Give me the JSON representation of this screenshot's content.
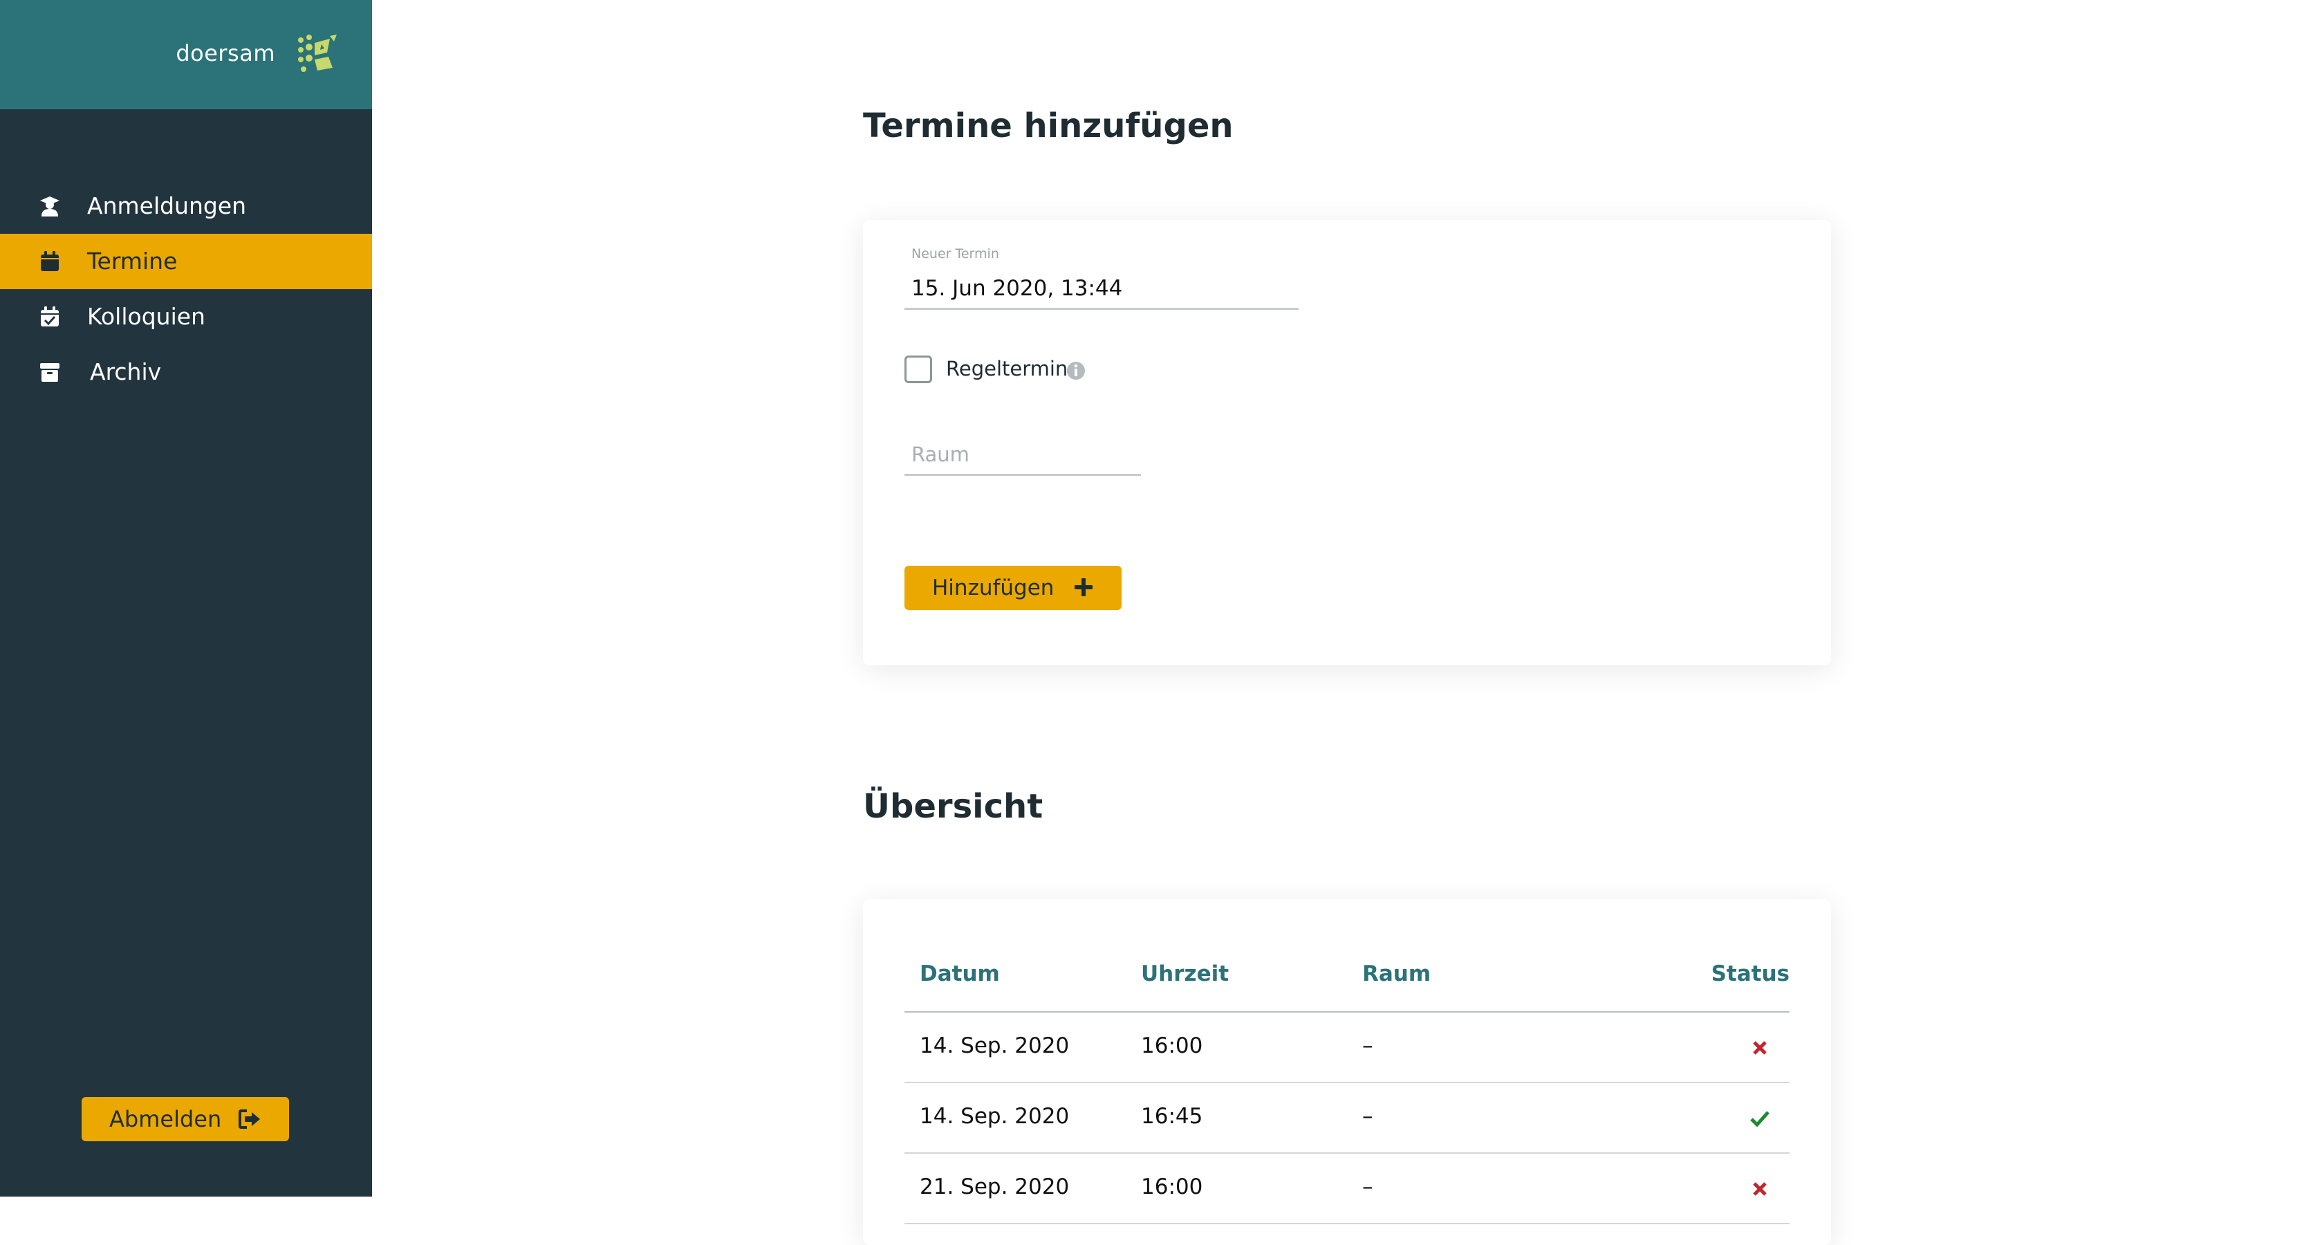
{
  "brand": {
    "name": "doersam",
    "logo_icon": "doersam-logo-icon"
  },
  "sidebar": {
    "items": [
      {
        "label": "Anmeldungen",
        "icon": "graduate-user-icon",
        "active": false
      },
      {
        "label": "Termine",
        "icon": "calendar-icon",
        "active": true
      },
      {
        "label": "Kolloquien",
        "icon": "calendar-check-icon",
        "active": false
      },
      {
        "label": "Archiv",
        "icon": "archive-box-icon",
        "active": false
      }
    ],
    "logout_label": "Abmelden",
    "logout_icon": "sign-out-icon"
  },
  "form": {
    "title": "Termine hinzufügen",
    "date_label": "Neuer Termin",
    "date_value": "15. Jun 2020, 13:44",
    "recurring_label": "Regeltermin",
    "recurring_checked": false,
    "room_placeholder": "Raum",
    "room_value": "",
    "add_label": "Hinzufügen"
  },
  "overview": {
    "title": "Übersicht",
    "columns": [
      "Datum",
      "Uhrzeit",
      "Raum",
      "Status"
    ],
    "rows": [
      {
        "date": "14. Sep. 2020",
        "time": "16:00",
        "room": "–",
        "status": "cancelled"
      },
      {
        "date": "14. Sep. 2020",
        "time": "16:45",
        "room": "–",
        "status": "confirmed"
      },
      {
        "date": "21. Sep. 2020",
        "time": "16:00",
        "room": "–",
        "status": "cancelled"
      }
    ]
  },
  "colors": {
    "sidebar_bg": "#22343e",
    "brand_bg": "#2b7279",
    "accent": "#eaa800",
    "table_header": "#2b7279",
    "status_cancelled": "#c0262d",
    "status_confirmed": "#1f8a2e"
  }
}
